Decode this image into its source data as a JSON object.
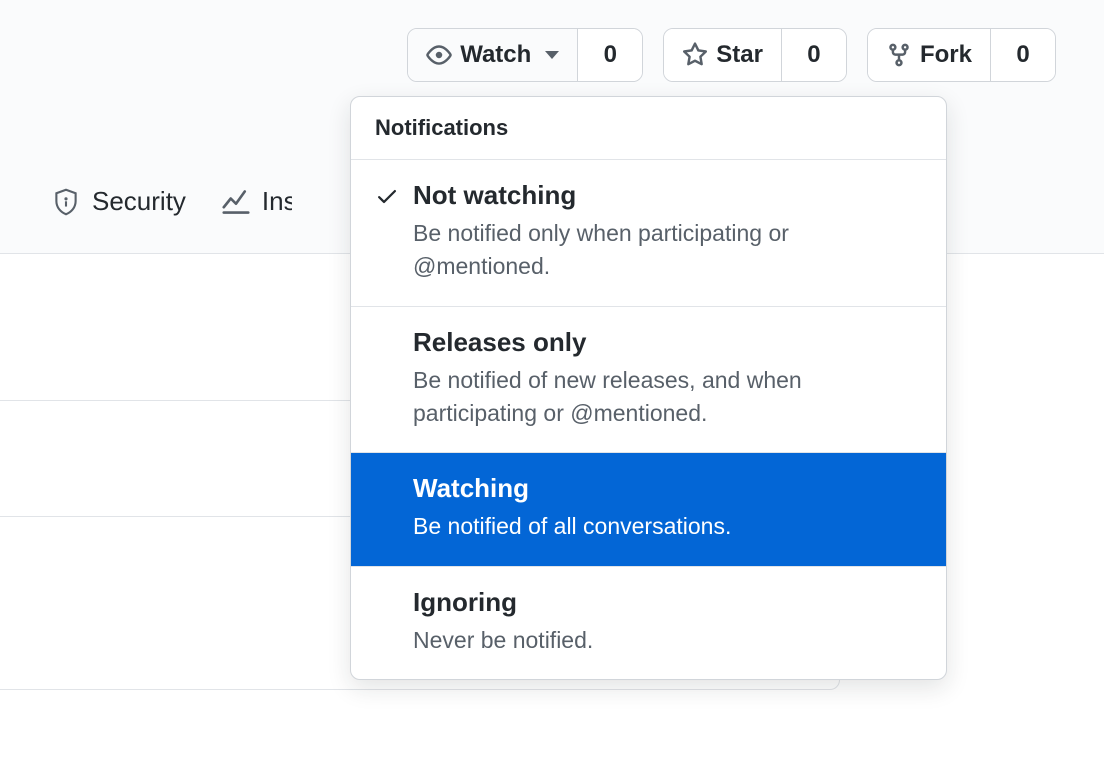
{
  "actions": {
    "watch": {
      "label": "Watch",
      "count": "0"
    },
    "star": {
      "label": "Star",
      "count": "0"
    },
    "fork": {
      "label": "Fork",
      "count": "0"
    }
  },
  "tabs": {
    "security": "Security",
    "insights": "Insights"
  },
  "dropdown": {
    "header": "Notifications",
    "items": [
      {
        "title": "Not watching",
        "desc": "Be notified only when participating or @mentioned.",
        "checked": true,
        "highlighted": false
      },
      {
        "title": "Releases only",
        "desc": "Be notified of new releases, and when participating or @mentioned.",
        "checked": false,
        "highlighted": false
      },
      {
        "title": "Watching",
        "desc": "Be notified of all conversations.",
        "checked": false,
        "highlighted": true
      },
      {
        "title": "Ignoring",
        "desc": "Never be notified.",
        "checked": false,
        "highlighted": false
      }
    ]
  }
}
